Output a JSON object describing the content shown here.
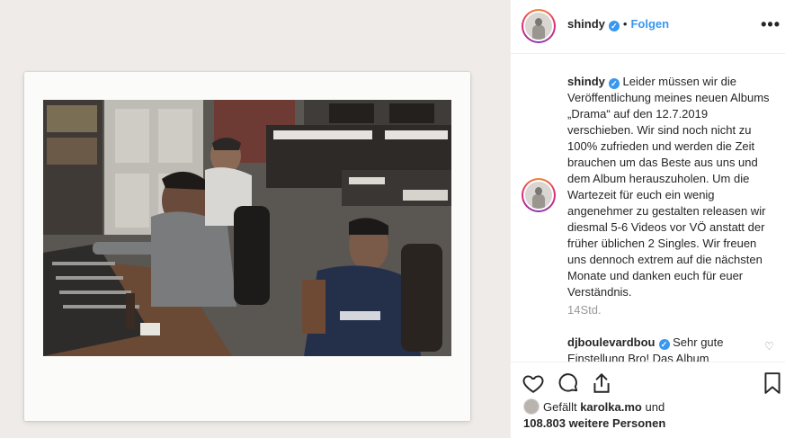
{
  "post": {
    "username": "shindy",
    "separator": "•",
    "follow_label": "Folgen",
    "more_label": "•••"
  },
  "caption": {
    "username": "shindy",
    "text": "Leider müssen wir die Veröffentlichung meines neuen Albums „Drama“ auf den 12.7.2019 verschieben. Wir sind noch nicht zu 100% zufrieden und werden die Zeit brauchen um das Beste aus uns und dem Album herauszuholen. Um die Wartezeit für euch ein wenig angenehmer zu gestalten releasen wir diesmal 5-6 Videos vor VÖ anstatt der früher üblichen 2 Singles. Wir freuen uns dennoch extrem auf die nächsten Monate und danken euch für euer Verständnis.",
    "time": "14Std."
  },
  "comment": {
    "username": "djboulevardbou",
    "text": "Sehr gute Einstellung Bro! Das Album"
  },
  "likes": {
    "prefix": "Gefällt",
    "user": "karolka.mo",
    "conj": "und",
    "count": "108.803 weitere Personen"
  },
  "icons": {
    "verified": "✓",
    "heart_small": "♡"
  }
}
